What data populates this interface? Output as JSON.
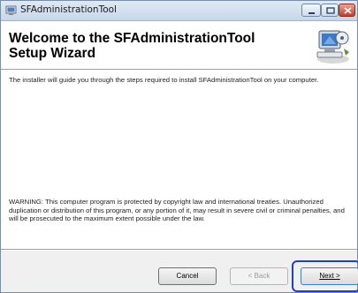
{
  "window": {
    "title": "SFAdministrationTool"
  },
  "header": {
    "heading": "Welcome to the SFAdministrationTool Setup Wizard",
    "art_icon": "setup-wizard-computer-icon"
  },
  "content": {
    "intro": "The installer will guide you through the steps required to install SFAdministrationTool on your computer.",
    "warning": "WARNING: This computer program is protected by copyright law and international treaties. Unauthorized duplication or distribution of this program, or any portion of it, may result in severe civil or criminal penalties, and will be prosecuted to the maximum extent possible under the law."
  },
  "buttons": {
    "cancel": "Cancel",
    "back": "< Back",
    "next": "Next >"
  },
  "colors": {
    "focus_ring": "#1e3fd2",
    "close_button": "#c4402a"
  }
}
